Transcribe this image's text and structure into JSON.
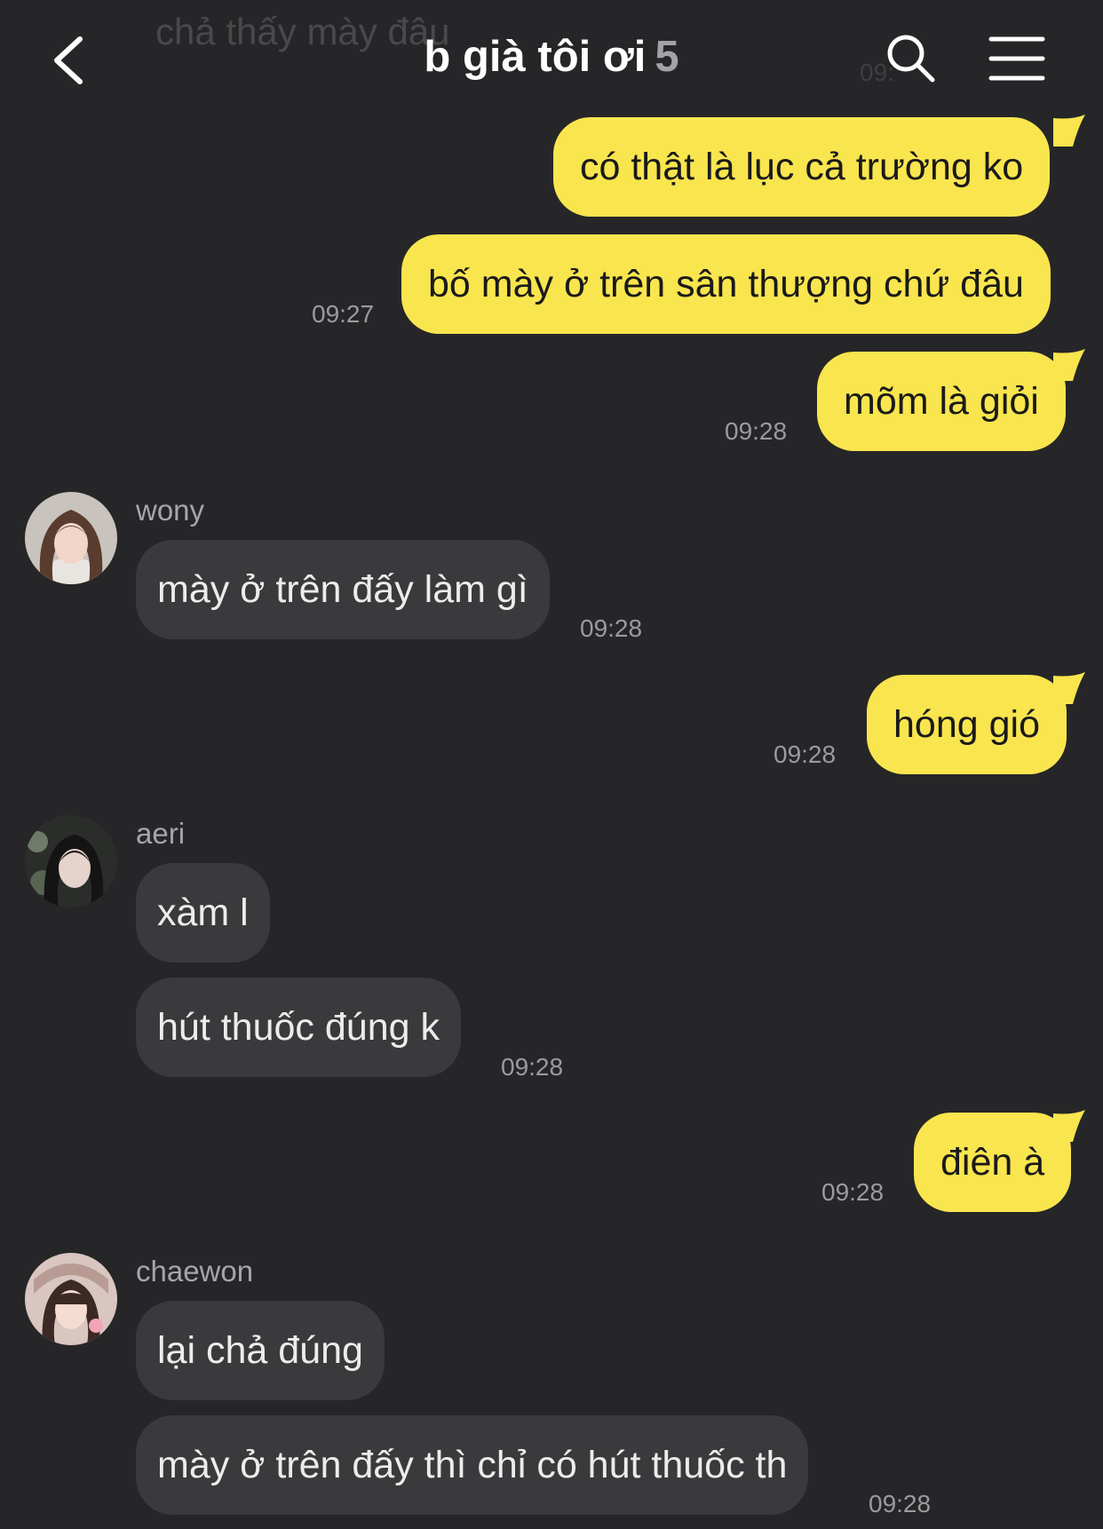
{
  "header": {
    "title": "b già tôi ơi",
    "member_count": "5",
    "ghost_text": "chả thấy mày đâu",
    "ghost_time": "09:"
  },
  "icons": [
    "chevron-left-icon",
    "search-icon",
    "hamburger-menu-icon"
  ],
  "colors": {
    "background": "#262628",
    "outgoing_bubble": "#f9e54e",
    "incoming_bubble": "#3a3a3d"
  },
  "messages": [
    {
      "direction": "out",
      "text": "có thật là lục cả trường ko",
      "time": ""
    },
    {
      "direction": "out",
      "text": "bố mày ở trên sân thượng chứ đâu",
      "time": "09:27"
    },
    {
      "direction": "out",
      "text": "mõm là giỏi",
      "time": "09:28"
    },
    {
      "direction": "in",
      "sender": "wony",
      "text": "mày ở trên đấy làm gì",
      "time": "09:28"
    },
    {
      "direction": "out",
      "text": "hóng gió",
      "time": "09:28"
    },
    {
      "direction": "in",
      "sender": "aeri",
      "text": "xàm l",
      "time": ""
    },
    {
      "direction": "in",
      "text": "hút thuốc đúng k",
      "time": "09:28"
    },
    {
      "direction": "out",
      "text": "điên à",
      "time": "09:28"
    },
    {
      "direction": "in",
      "sender": "chaewon",
      "text": "lại chả đúng",
      "time": ""
    },
    {
      "direction": "in",
      "text": "mày ở trên đấy thì chỉ có hút thuốc th",
      "time": "09:28"
    }
  ]
}
